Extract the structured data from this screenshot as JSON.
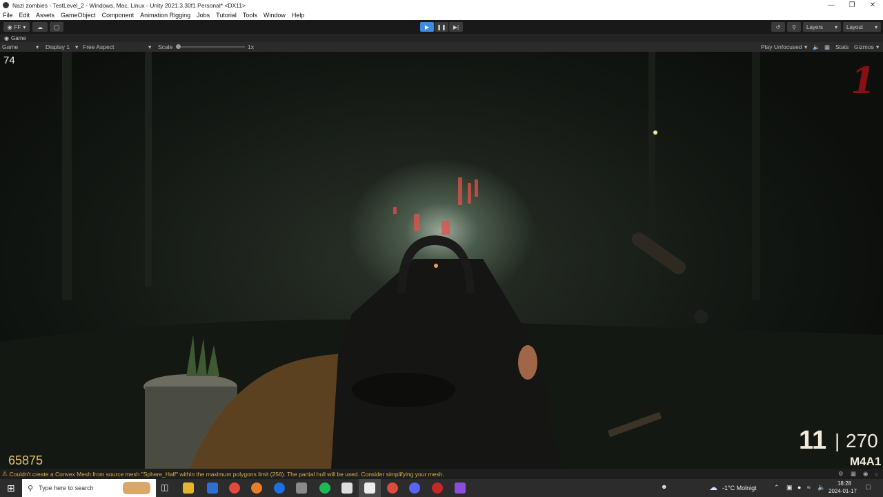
{
  "window": {
    "title": "Nazi zombies - TestLevel_2 - Windows, Mac, Linux - Unity 2021.3.30f1 Personal* <DX11>"
  },
  "menu": [
    "File",
    "Edit",
    "Assets",
    "GameObject",
    "Component",
    "Animation Rigging",
    "Jobs",
    "Tutorial",
    "Tools",
    "Window",
    "Help"
  ],
  "toolbar": {
    "account_label": "FF",
    "layers_label": "Layers",
    "layout_label": "Layout"
  },
  "tab": {
    "label": "Game"
  },
  "gamebar": {
    "mode": "Game",
    "display": "Display 1",
    "aspect": "Free Aspect",
    "scale_label": "Scale",
    "scale_value": "1x",
    "play_mode": "Play Unfocused",
    "stats": "Stats",
    "gizmos": "Gizmos"
  },
  "hud": {
    "fps": "74",
    "round": "1",
    "points": "65875",
    "ammo_clip": "11",
    "ammo_separator": "|",
    "ammo_reserve": "270",
    "weapon": "M4A1"
  },
  "console": {
    "message": "Couldn't create a Convex Mesh from source mesh \"Sphere_Half\" within the maximum polygons limit (256). The partial hull will be used. Consider simplifying your mesh."
  },
  "taskbar": {
    "search_placeholder": "Type here to search",
    "weather": "-1°C  Molnigt",
    "time": "18:28",
    "date": "2024-01-17"
  },
  "colors": {
    "accent": "#3d8be0",
    "hud_points": "#e8c36a",
    "hud_round": "#8a0f12",
    "warning": "#d8b24a"
  }
}
